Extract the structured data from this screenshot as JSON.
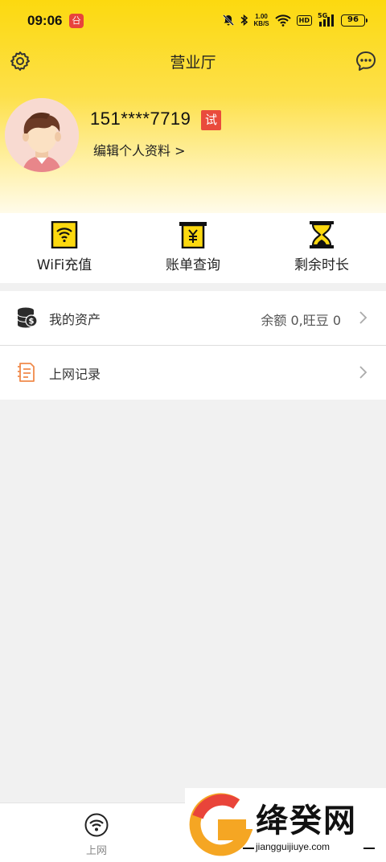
{
  "status_bar": {
    "time": "09:06",
    "app_icon_text": "㕣",
    "net_speed_top": "1.00",
    "net_speed_unit": "KB/S",
    "hd": "HD",
    "net_type": "5G",
    "battery": "96"
  },
  "header": {
    "title": "营业厅",
    "settings_icon": "gear-icon",
    "chat_icon": "chat-bubble-icon"
  },
  "profile": {
    "phone": "151****7719",
    "badge": "试",
    "edit_label": "编辑个人资料 >"
  },
  "quick_actions": [
    {
      "icon": "wifi-recharge-icon",
      "label": "WiFi充值"
    },
    {
      "icon": "bill-query-icon",
      "label": "账单查询"
    },
    {
      "icon": "hourglass-icon",
      "label": "剩余时长"
    }
  ],
  "menu": [
    {
      "icon": "coins-icon",
      "label": "我的资产",
      "value": "余额 0,旺豆 0"
    },
    {
      "icon": "document-icon",
      "label": "上网记录",
      "value": ""
    }
  ],
  "tab_bar": {
    "tabs": [
      {
        "icon": "wifi-icon",
        "label": "上网"
      }
    ]
  },
  "watermark": {
    "name": "绛癸网",
    "url": "jiangguijiuye.com"
  },
  "colors": {
    "brand_yellow": "#fcd90f",
    "badge_red": "#e94b3c",
    "icon_orange": "#f08a4b"
  }
}
